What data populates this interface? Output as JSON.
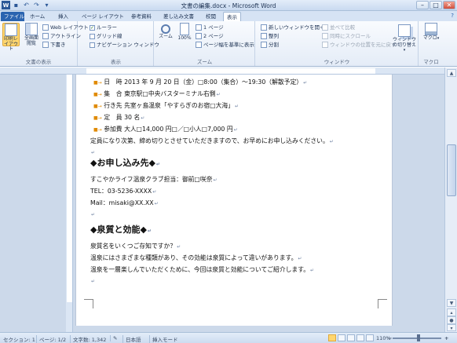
{
  "window": {
    "title": "文書の編集.docx - Microsoft Word"
  },
  "tabs": [
    "ファイル",
    "ホーム",
    "挿入",
    "ページ レイアウト",
    "参考資料",
    "差し込み文書",
    "校閲",
    "表示"
  ],
  "ribbon": {
    "doc_view": {
      "label": "文書の表示",
      "print_layout": "印刷レイアウト",
      "full_screen": "全画面閲覧",
      "web_layout": "Web レイアウト",
      "outline": "アウトライン",
      "draft": "下書き"
    },
    "show": {
      "label": "表示",
      "ruler": "ルーラー",
      "gridlines": "グリッド線",
      "nav_pane": "ナビゲーション ウィンドウ"
    },
    "zoom": {
      "label": "ズーム",
      "zoom": "ズーム",
      "hundred": "100%",
      "one_page": "1 ページ",
      "two_pages": "2 ページ",
      "page_width": "ページ幅を基準に表示"
    },
    "window": {
      "label": "ウィンドウ",
      "new_window": "新しいウィンドウを開く",
      "arrange": "整列",
      "split": "分割",
      "side_by_side": "並べて比較",
      "sync_scroll": "同時にスクロール",
      "reset_pos": "ウィンドウの位置を元に戻す",
      "switch": "ウィンドウの切り替え"
    },
    "macro": {
      "label": "マクロ",
      "macro": "マクロ"
    }
  },
  "document": {
    "list": [
      {
        "key": "日　時",
        "value": "2013 年 9 月 20 日（金）□8:00（集合）～19:30（解散予定）"
      },
      {
        "key": "集　合",
        "value": "東京駅□中央バスターミナル右側"
      },
      {
        "key": "行き先",
        "value": "先室ヶ島温泉「やすらぎのお宿□大海」"
      },
      {
        "key": "定　員",
        "value": "30 名"
      },
      {
        "key": "参加費",
        "value": "大人□14,000 円□／□小人□7,000 円"
      }
    ],
    "note": "定員になり次第、締め切りとさせていただきますので、お早めにお申し込みください。",
    "heading1": "◆お申し込み先◆",
    "contact_org": "すこやかライフ温泉クラブ担当：御前□咲奈",
    "contact_tel": "TEL：03-5236-XXXX",
    "contact_mail": "Mail：misaki@XX.XX",
    "heading2": "◆泉質と効能◆",
    "para1": "泉質名をいくつご存知ですか？",
    "para2": "温泉にはさまざまな種類があり、その効能は泉質によって違いがあります。",
    "para3": "温泉を一層楽しんでいただくために、今回は泉質と効能についてご紹介します。"
  },
  "status": {
    "section": "セクション: 1",
    "page": "ページ: 1/2",
    "words": "文字数: 1,342",
    "lang": "日本語",
    "mode": "挿入モード",
    "zoom": "110%"
  },
  "zoom_level": 1.1
}
